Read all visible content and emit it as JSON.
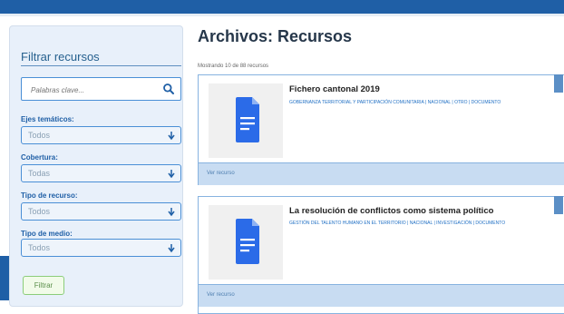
{
  "sidebar": {
    "title": "Filtrar recursos",
    "search": {
      "placeholder": "Palabras clave..."
    },
    "filters": [
      {
        "label": "Ejes temáticos:",
        "value": "Todos"
      },
      {
        "label": "Cobertura:",
        "value": "Todas"
      },
      {
        "label": "Tipo de recurso:",
        "value": "Todos"
      },
      {
        "label": "Tipo de medio:",
        "value": "Todos"
      }
    ],
    "button_label": "Filtrar"
  },
  "main": {
    "title": "Archivos: Recursos",
    "count_text": "Mostrando 10 de 88 recursos",
    "cards": [
      {
        "title": "Fichero cantonal 2019",
        "meta": "GOBERNANZA TERRITORIAL Y PARTICIPACIÓN COMUNITARIA | NACIONAL | OTRO | DOCUMENTO",
        "footer_label": "Ver recurso"
      },
      {
        "title": "La resolución de conflictos como sistema político",
        "meta": "GESTIÓN DEL TALENTO HUMANO EN EL TERRITORIO | NACIONAL | INVESTIGACIÓN | DOCUMENTO",
        "footer_label": "Ver recurso"
      }
    ]
  },
  "colors": {
    "brand": "#1f5fa6",
    "accent": "#4a8fd6",
    "filter_button": "#8ccd7a",
    "doc_icon": "#2b6be8"
  },
  "icons": [
    "search-icon",
    "chevron-down-icon",
    "document-icon"
  ]
}
